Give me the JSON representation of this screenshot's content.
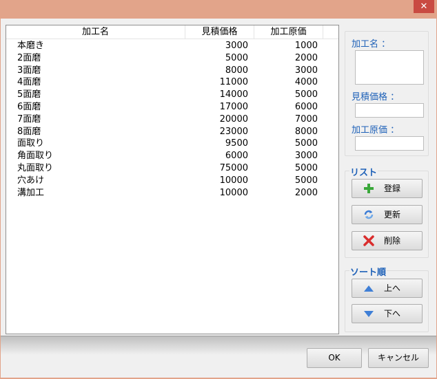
{
  "window": {
    "close_label": "✕"
  },
  "list": {
    "columns": [
      "加工名",
      "見積価格",
      "加工原価"
    ],
    "rows": [
      {
        "name": "本磨き",
        "est": "3000",
        "cost": "1000"
      },
      {
        "name": "2面磨",
        "est": "5000",
        "cost": "2000"
      },
      {
        "name": "3面磨",
        "est": "8000",
        "cost": "3000"
      },
      {
        "name": "4面磨",
        "est": "11000",
        "cost": "4000"
      },
      {
        "name": "5面磨",
        "est": "14000",
        "cost": "5000"
      },
      {
        "name": "6面磨",
        "est": "17000",
        "cost": "6000"
      },
      {
        "name": "7面磨",
        "est": "20000",
        "cost": "7000"
      },
      {
        "name": "8面磨",
        "est": "23000",
        "cost": "8000"
      },
      {
        "name": "面取り",
        "est": "9500",
        "cost": "5000"
      },
      {
        "name": "角面取り",
        "est": "6000",
        "cost": "3000"
      },
      {
        "name": "丸面取り",
        "est": "75000",
        "cost": "5000"
      },
      {
        "name": "穴あけ",
        "est": "10000",
        "cost": "5000"
      },
      {
        "name": "溝加工",
        "est": "10000",
        "cost": "2000"
      }
    ]
  },
  "form": {
    "name_label": "加工名 ：",
    "name_value": "",
    "est_label": "見積価格 ：",
    "est_value": "",
    "cost_label": "加工原価 ：",
    "cost_value": ""
  },
  "list_group": {
    "title": "リスト",
    "register": "登録",
    "update": "更新",
    "delete": "削除"
  },
  "sort_group": {
    "title": "ソート順",
    "up": "上へ",
    "down": "下へ"
  },
  "dialog": {
    "ok": "OK",
    "cancel": "キャンセル"
  },
  "icons": [
    "plus-icon",
    "refresh-icon",
    "delete-x-icon",
    "up-arrow-icon",
    "down-arrow-icon"
  ]
}
